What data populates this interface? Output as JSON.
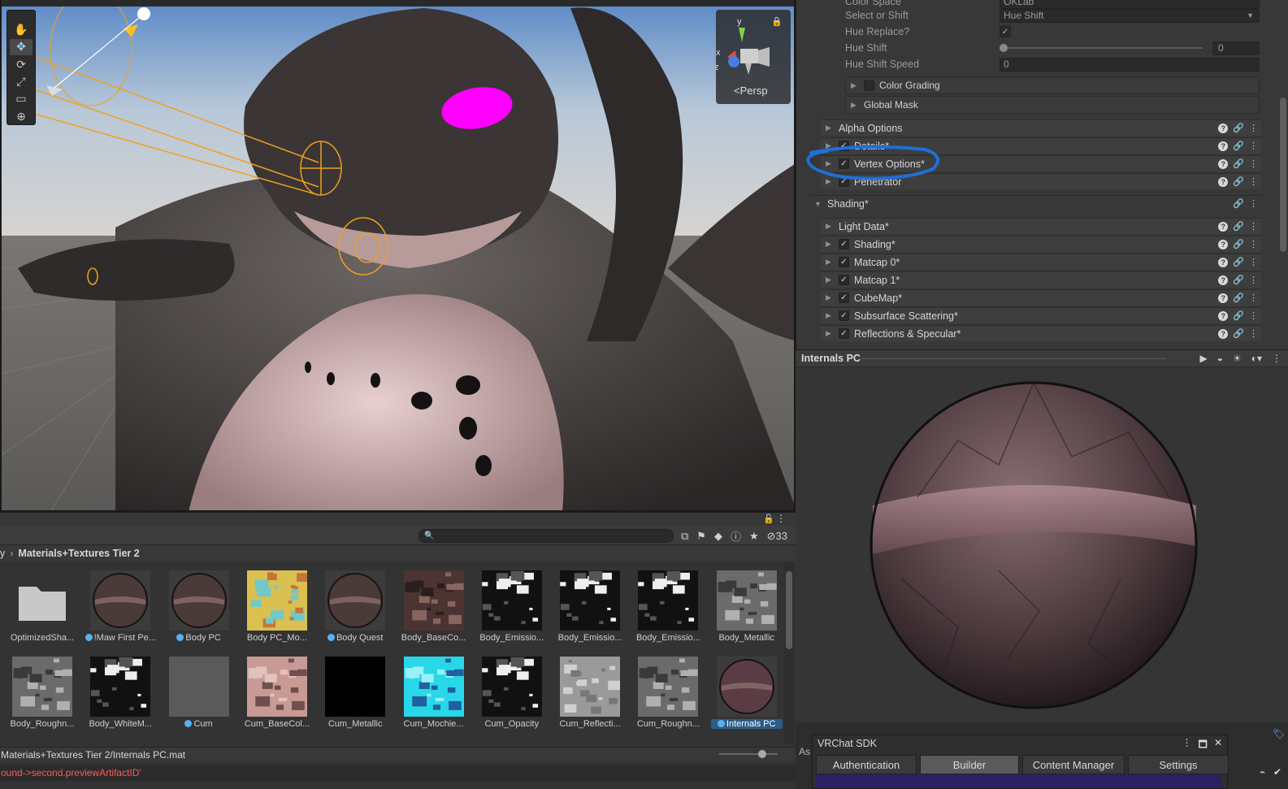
{
  "scene": {
    "view_mode": "Persp",
    "gizmo_axes": [
      "y",
      "x",
      "z"
    ],
    "tools": [
      {
        "name": "hand-tool",
        "glyph": "✋"
      },
      {
        "name": "move-tool",
        "glyph": "✥"
      },
      {
        "name": "rotate-tool",
        "glyph": "⟳"
      },
      {
        "name": "scale-tool",
        "glyph": "⤢"
      },
      {
        "name": "rect-tool",
        "glyph": "▭"
      },
      {
        "name": "transform-tool",
        "glyph": "⊕"
      }
    ]
  },
  "inspector": {
    "props": {
      "color_space_label": "Color Space",
      "color_space_value": "OKLab",
      "select_shift_label": "Select or Shift",
      "select_shift_value": "Hue Shift",
      "hue_replace_label": "Hue Replace?",
      "hue_shift_label": "Hue Shift",
      "hue_shift_value": "0",
      "hue_shift_speed_label": "Hue Shift Speed",
      "hue_shift_speed_value": "0"
    },
    "sub_sections": [
      "Color Grading",
      "Global Mask"
    ],
    "sections": [
      {
        "label": "Alpha Options",
        "checkbox": false
      },
      {
        "label": "Details*",
        "checkbox": true
      },
      {
        "label": "Vertex Options*",
        "checkbox": true
      },
      {
        "label": "Penetrator",
        "checkbox": true
      }
    ],
    "shading_header": "Shading*",
    "shading_sections": [
      {
        "label": "Light Data*",
        "checkbox": false
      },
      {
        "label": "Shading*",
        "checkbox": true
      },
      {
        "label": "Matcap 0*",
        "checkbox": true
      },
      {
        "label": "Matcap 1*",
        "checkbox": true
      },
      {
        "label": "CubeMap*",
        "checkbox": true
      },
      {
        "label": "Subsurface Scattering*",
        "checkbox": true
      },
      {
        "label": "Reflections & Specular*",
        "checkbox": true
      }
    ]
  },
  "preview": {
    "title": "Internals PC"
  },
  "vrchat_sdk": {
    "title": "VRChat SDK",
    "tabs": [
      "Authentication",
      "Builder",
      "Content Manager",
      "Settings"
    ],
    "active_tab": "Builder"
  },
  "project": {
    "search_placeholder": "",
    "hidden_count": "33",
    "breadcrumb_prefix": "y",
    "breadcrumb_current": "Materials+Textures Tier 2",
    "assets_row1": [
      {
        "label": "OptimizedSha...",
        "kind": "folder"
      },
      {
        "label": "!Maw First Pe...",
        "kind": "material",
        "dot": true
      },
      {
        "label": "Body PC",
        "kind": "material",
        "dot": true
      },
      {
        "label": "Body PC_Mo...",
        "kind": "texture-noise"
      },
      {
        "label": "Body Quest",
        "kind": "material",
        "dot": true
      },
      {
        "label": "Body_BaseCo...",
        "kind": "texture-skin"
      },
      {
        "label": "Body_Emissio...",
        "kind": "texture-bw"
      },
      {
        "label": "Body_Emissio...",
        "kind": "texture-bw"
      },
      {
        "label": "Body_Emissio...",
        "kind": "texture-bw"
      },
      {
        "label": "Body_Metallic",
        "kind": "texture-gray"
      }
    ],
    "assets_row2": [
      {
        "label": "Body_Roughn...",
        "kind": "texture-gray"
      },
      {
        "label": "Body_WhiteM...",
        "kind": "texture-bw"
      },
      {
        "label": "Cum",
        "kind": "flat-gray",
        "dot": true
      },
      {
        "label": "Cum_BaseCol...",
        "kind": "texture-pink"
      },
      {
        "label": "Cum_Metallic",
        "kind": "flat-black"
      },
      {
        "label": "Cum_Mochie...",
        "kind": "texture-cyan"
      },
      {
        "label": "Cum_Opacity",
        "kind": "texture-bw"
      },
      {
        "label": "Cum_Reflecti...",
        "kind": "texture-lightgray"
      },
      {
        "label": "Cum_Roughn...",
        "kind": "texture-gray"
      },
      {
        "label": "Internals PC",
        "kind": "material-red",
        "dot": true,
        "selected": true
      }
    ],
    "status_path": "Materials+Textures Tier 2/Internals PC.mat",
    "console_error": "ound->second.previewArtifactID'",
    "assets_tab": "As"
  },
  "colors": {
    "accent_blue": "#2c5d87",
    "highlight_annotation": "#1f6fd8",
    "error_red": "#ff5a5a"
  }
}
